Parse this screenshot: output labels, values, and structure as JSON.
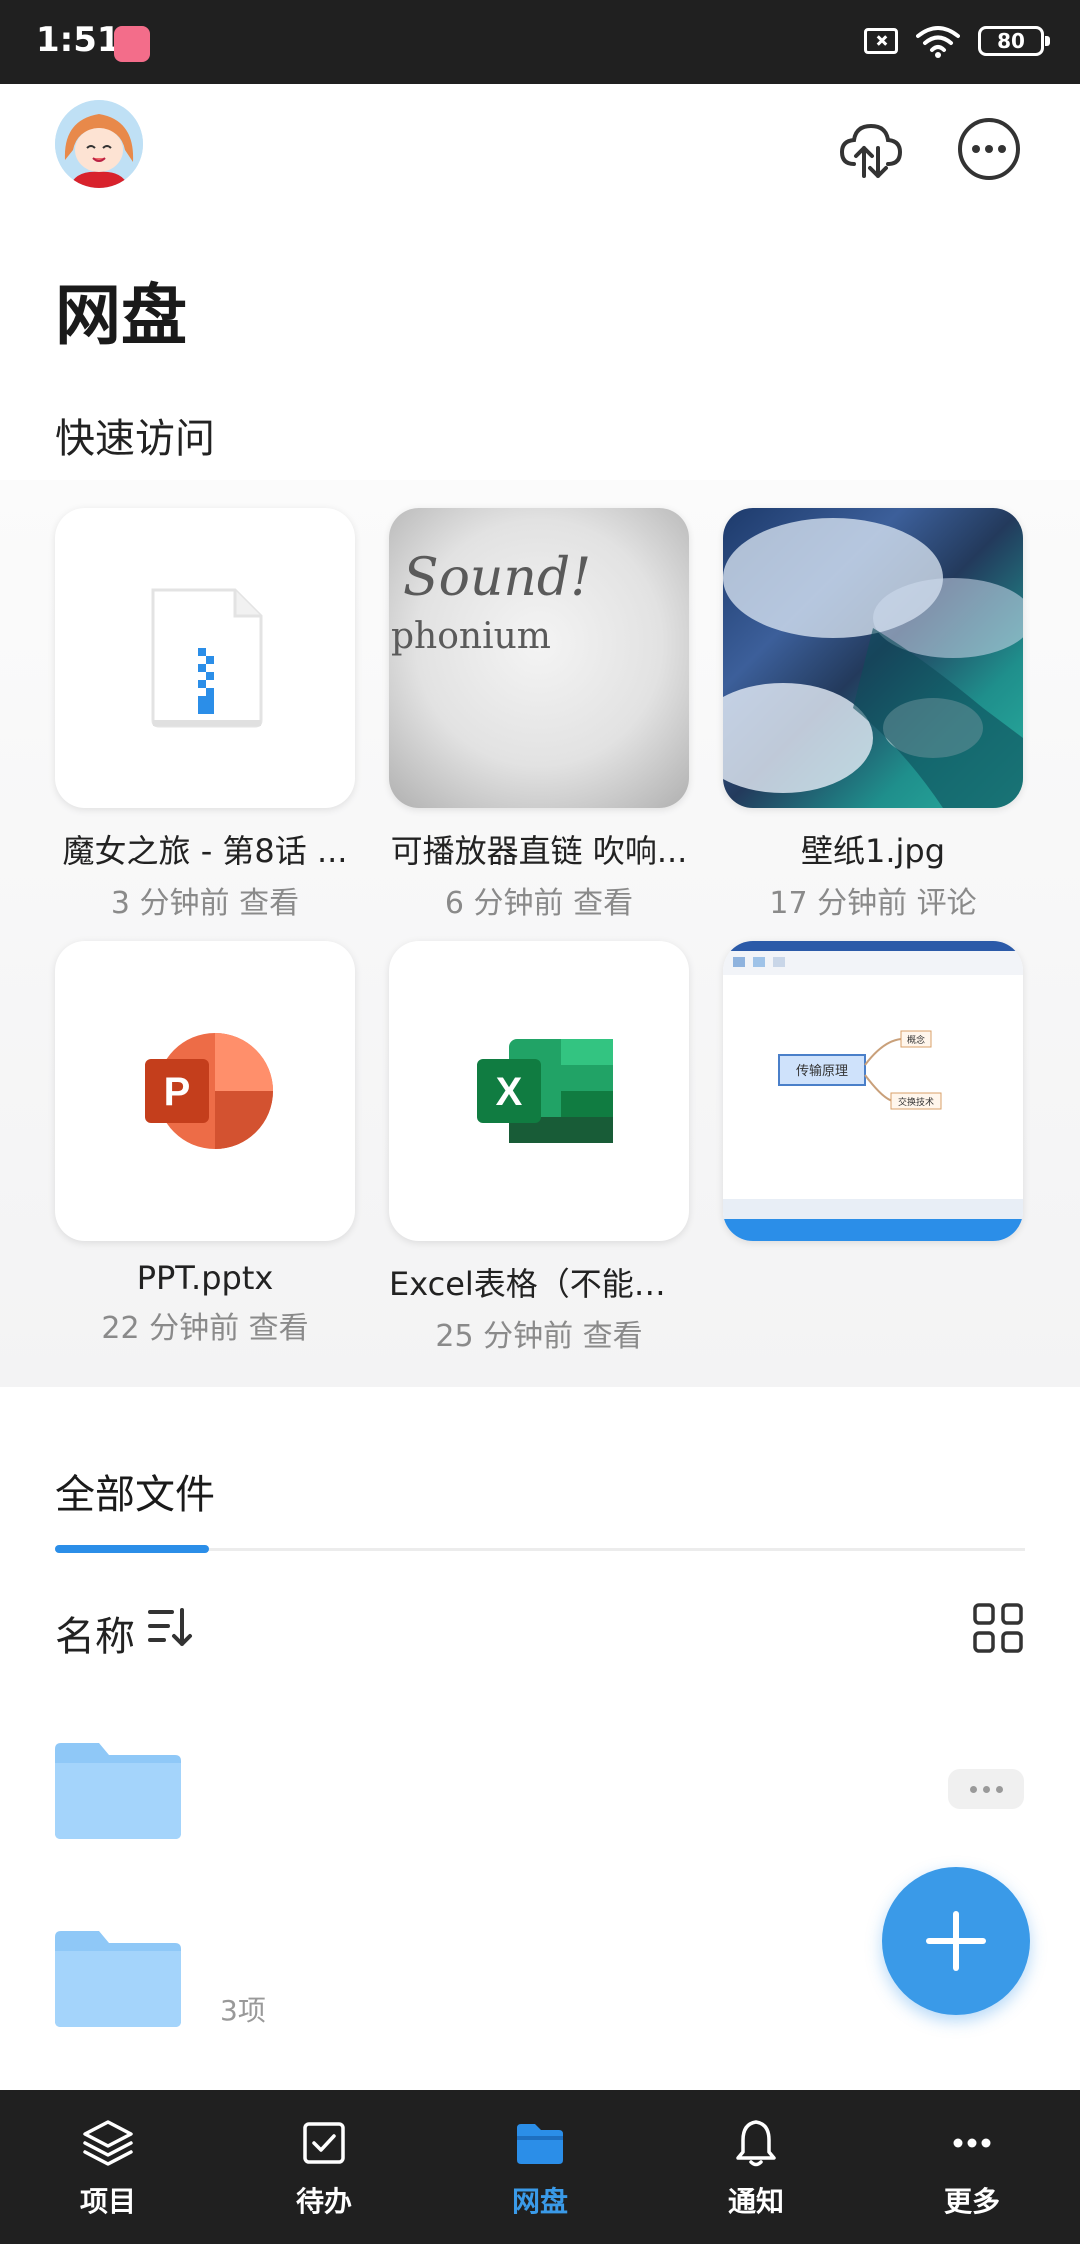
{
  "status_bar": {
    "time": "1:51",
    "battery": "80"
  },
  "header": {
    "title": "网盘"
  },
  "quick_access": {
    "title": "快速访问",
    "items": [
      {
        "name": "魔女之旅 - 第8话 ...",
        "meta": "3 分钟前 查看",
        "type": "zip"
      },
      {
        "name": "可播放器直链 吹响...",
        "meta": "6 分钟前 查看",
        "type": "image",
        "thumb_text_1": "Sound!",
        "thumb_text_2": "phonium"
      },
      {
        "name": "壁纸1.jpg",
        "meta": "17 分钟前 评论",
        "type": "image"
      },
      {
        "name": "PPT.pptx",
        "meta": "22 分钟前 查看",
        "type": "pptx"
      },
      {
        "name": "Excel表格（不能预...",
        "meta": "25 分钟前 查看",
        "type": "xlsx"
      },
      {
        "name": "",
        "meta": "",
        "type": "image",
        "thumb_text": "传输原理",
        "thumb_tag_1": "概念",
        "thumb_tag_2": "交换技术"
      }
    ]
  },
  "all_files": {
    "tab_label": "全部文件",
    "sort_label": "名称",
    "rows": [
      {
        "name": "",
        "meta": ""
      },
      {
        "name": "",
        "meta": "3项"
      }
    ]
  },
  "colors": {
    "accent": "#3a9ae8",
    "nav_bg": "#202020"
  },
  "bottom_nav": {
    "items": [
      {
        "label": "项目",
        "icon": "layers-icon"
      },
      {
        "label": "待办",
        "icon": "checkbox-icon"
      },
      {
        "label": "网盘",
        "icon": "folder-icon",
        "active": true
      },
      {
        "label": "通知",
        "icon": "bell-icon"
      },
      {
        "label": "更多",
        "icon": "more-icon"
      }
    ]
  }
}
